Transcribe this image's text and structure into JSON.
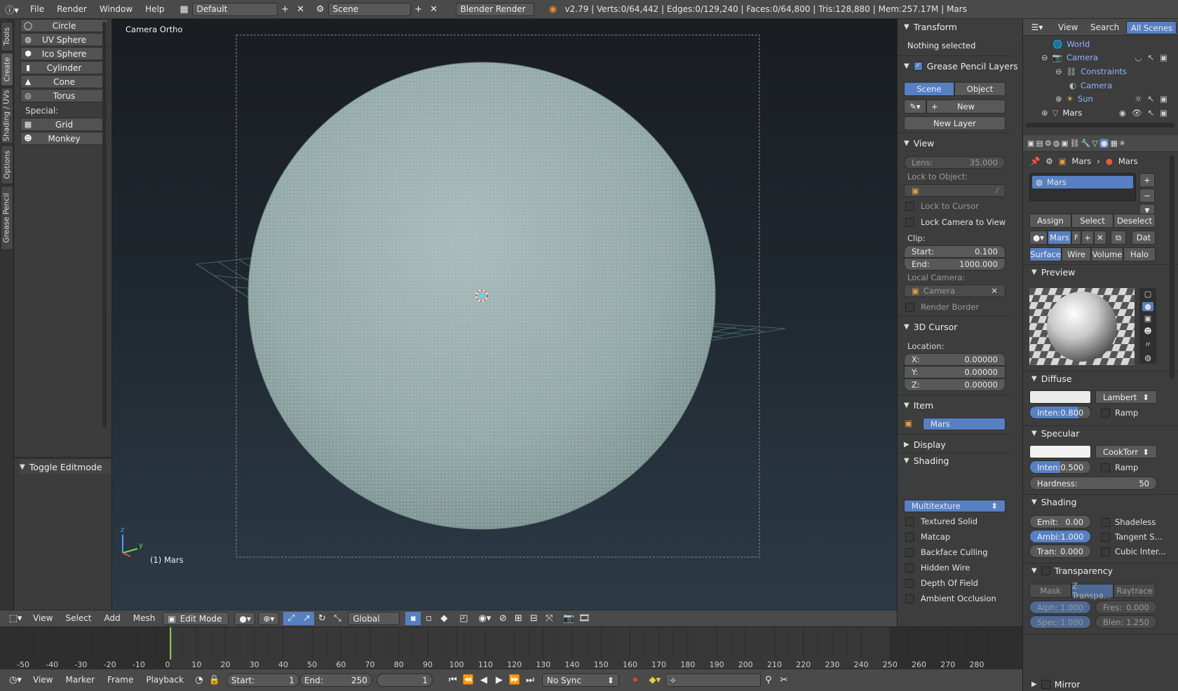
{
  "topbar": {
    "menus": [
      "File",
      "Render",
      "Window",
      "Help"
    ],
    "layout": "Default",
    "scene": "Scene",
    "engine": "Blender Render",
    "stats": "v2.79 | Verts:0/64,442 | Edges:0/129,240 | Faces:0/64,800 | Tris:128,880 | Mem:257.17M | Mars"
  },
  "left_tabs": [
    "Tools",
    "Create",
    "Shading / UVs",
    "Options",
    "Grease Pencil"
  ],
  "toolshelf": {
    "items": [
      "Circle",
      "UV Sphere",
      "Ico Sphere",
      "Cylinder",
      "Cone",
      "Torus"
    ],
    "special_label": "Special:",
    "special_items": [
      "Grid",
      "Monkey"
    ],
    "last_op": "Toggle Editmode"
  },
  "viewport": {
    "view_name": "Camera Ortho",
    "object_label": "(1) Mars",
    "axis_z": "z",
    "axis_y": "y"
  },
  "vp_header": {
    "menus": [
      "View",
      "Select",
      "Add",
      "Mesh"
    ],
    "mode": "Edit Mode",
    "orientation": "Global"
  },
  "npanel": {
    "transform": "Transform",
    "nothing_selected": "Nothing selected",
    "grease_pencil": "Grease Pencil Layers",
    "gp_tabs": [
      "Scene",
      "Object"
    ],
    "gp_new": "New",
    "gp_new_layer": "New Layer",
    "view": "View",
    "lens_label": "Lens:",
    "lens_value": "35.000",
    "lock_to_object": "Lock to Object:",
    "lock_to_cursor": "Lock to Cursor",
    "lock_camera": "Lock Camera to View",
    "clip": "Clip:",
    "clip_start_label": "Start:",
    "clip_start": "0.100",
    "clip_end_label": "End:",
    "clip_end": "1000.000",
    "local_camera": "Local Camera:",
    "local_camera_value": "Camera",
    "render_border": "Render Border",
    "cursor": "3D Cursor",
    "location": "Location:",
    "cx_label": "X:",
    "cx": "0.00000",
    "cy_label": "Y:",
    "cy": "0.00000",
    "cz_label": "Z:",
    "cz": "0.00000",
    "item": "Item",
    "item_name": "Mars",
    "display": "Display",
    "shading": "Shading",
    "shading_mode": "Multitexture",
    "shading_checks": [
      "Textured Solid",
      "Matcap",
      "Backface Culling",
      "Hidden Wire",
      "Depth Of Field",
      "Ambient Occlusion"
    ]
  },
  "outliner": {
    "menus": [
      "View",
      "Search"
    ],
    "scope": "All Scenes",
    "rows": [
      "World",
      "Camera",
      "Constraints",
      "Camera",
      "Sun",
      "Mars"
    ]
  },
  "properties": {
    "breadcrumb_obj": "Mars",
    "breadcrumb_mat": "Mars",
    "slot": "Mars",
    "assign": "Assign",
    "select": "Select",
    "deselect": "Deselect",
    "material_name": "Mars",
    "mat_f": "F",
    "data_btn": "Dat",
    "tabs": [
      "Surface",
      "Wire",
      "Volume",
      "Halo"
    ],
    "preview": "Preview",
    "diffuse": "Diffuse",
    "diffuse_shader": "Lambert",
    "diffuse_inten_label": "Inten:",
    "diffuse_inten": "0.800",
    "diffuse_inten_frac": 0.8,
    "ramp": "Ramp",
    "specular": "Specular",
    "specular_shader": "CookTorr",
    "spec_inten_label": "Inten:",
    "spec_inten": "0.500",
    "spec_inten_frac": 0.5,
    "hardness_label": "Hardness:",
    "hardness": "50",
    "shading": "Shading",
    "emit_label": "Emit:",
    "emit": "0.00",
    "ambi_label": "Ambi:",
    "ambi": "1.000",
    "tran_label": "Tran:",
    "tran": "0.000",
    "shadeless": "Shadeless",
    "tangent": "Tangent S...",
    "cubic": "Cubic Inter...",
    "transparency": "Transparency",
    "trans_tabs": [
      "Mask",
      "Z Transpa...",
      "Raytrace"
    ],
    "alpha_label": "Alph:",
    "alpha": "1.000",
    "fres_label": "Fres:",
    "fres": "0.000",
    "spec_label": "Spec:",
    "spec": "1.000",
    "blen_label": "Blen:",
    "blen": "1.250",
    "mirror": "Mirror"
  },
  "timeline": {
    "ticks": [
      "-50",
      "-40",
      "-30",
      "-20",
      "-10",
      "0",
      "10",
      "20",
      "30",
      "40",
      "50",
      "60",
      "70",
      "80",
      "90",
      "100",
      "110",
      "120",
      "130",
      "140",
      "150",
      "160",
      "170",
      "180",
      "190",
      "200",
      "210",
      "220",
      "230",
      "240",
      "250",
      "260",
      "270",
      "280"
    ],
    "current_frame_value": 1
  },
  "tl_footer": {
    "menus": [
      "View",
      "Marker",
      "Frame",
      "Playback"
    ],
    "start_label": "Start:",
    "start": "1",
    "end_label": "End:",
    "end": "250",
    "current": "1",
    "sync": "No Sync"
  },
  "colors": {
    "accent": "#5680c2",
    "mesh": "#93aaa9",
    "outliner_text": "#8fb3ff"
  }
}
